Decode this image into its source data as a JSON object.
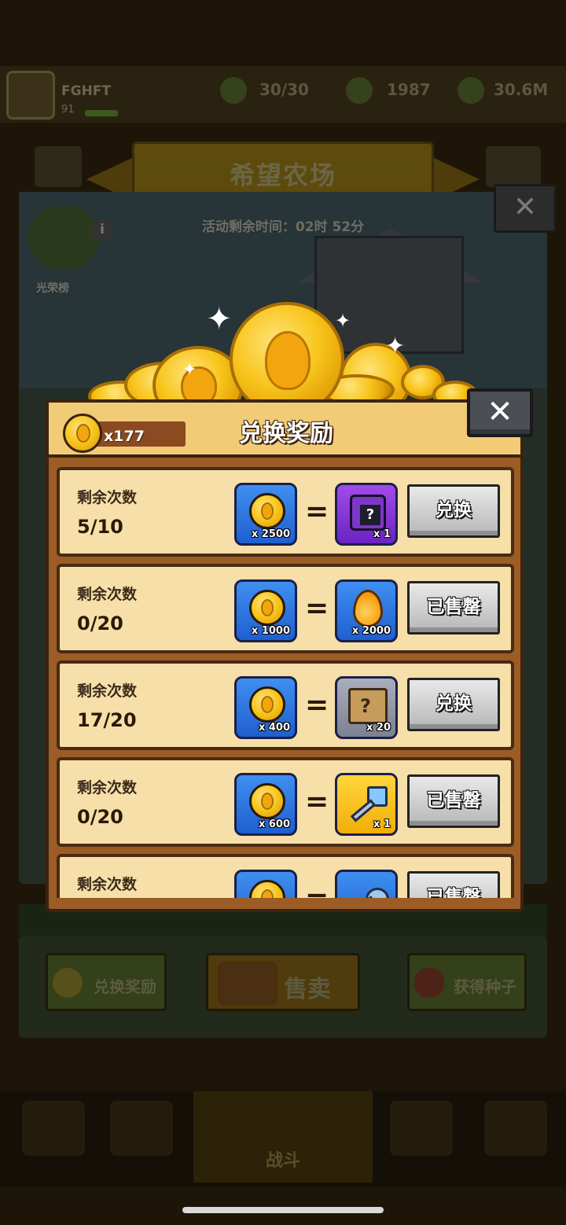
{
  "background": {
    "player_name": "FGHFT",
    "player_level": "91",
    "stats": [
      "30/30",
      "1987",
      "30.6M"
    ],
    "banner_title": "希望农场",
    "timer_text": "活动剩余时间：02时 52分",
    "honor_label": "光荣榜",
    "info_icon": "i",
    "close_glyph": "✕",
    "actions": {
      "exchange": "兑换奖励",
      "sell": "售卖",
      "seed": "获得种子"
    },
    "battle_label": "战斗"
  },
  "modal": {
    "title": "兑换奖励",
    "coin_count": "x177",
    "close_glyph": "✕",
    "equals_glyph": "=",
    "rows": [
      {
        "remain_label": "剩余次数",
        "remain": "5/10",
        "cost_qty": "x 2500",
        "reward_icon": "mystery-chest-icon",
        "reward_qty": "x 1",
        "button": "兑换"
      },
      {
        "remain_label": "剩余次数",
        "remain": "0/20",
        "cost_qty": "x 1000",
        "reward_icon": "golden-drop-icon",
        "reward_qty": "x 2000",
        "button": "已售罄"
      },
      {
        "remain_label": "剩余次数",
        "remain": "17/20",
        "cost_qty": "x 400",
        "reward_icon": "mystery-map-icon",
        "reward_qty": "x 20",
        "button": "兑换"
      },
      {
        "remain_label": "剩余次数",
        "remain": "0/20",
        "cost_qty": "x 600",
        "reward_icon": "blue-key-icon",
        "reward_qty": "x 1",
        "button": "已售罄"
      },
      {
        "remain_label": "剩余次数",
        "remain": "",
        "cost_qty": "",
        "reward_icon": "round-key-icon",
        "reward_qty": "",
        "button": "已售罄"
      }
    ]
  }
}
